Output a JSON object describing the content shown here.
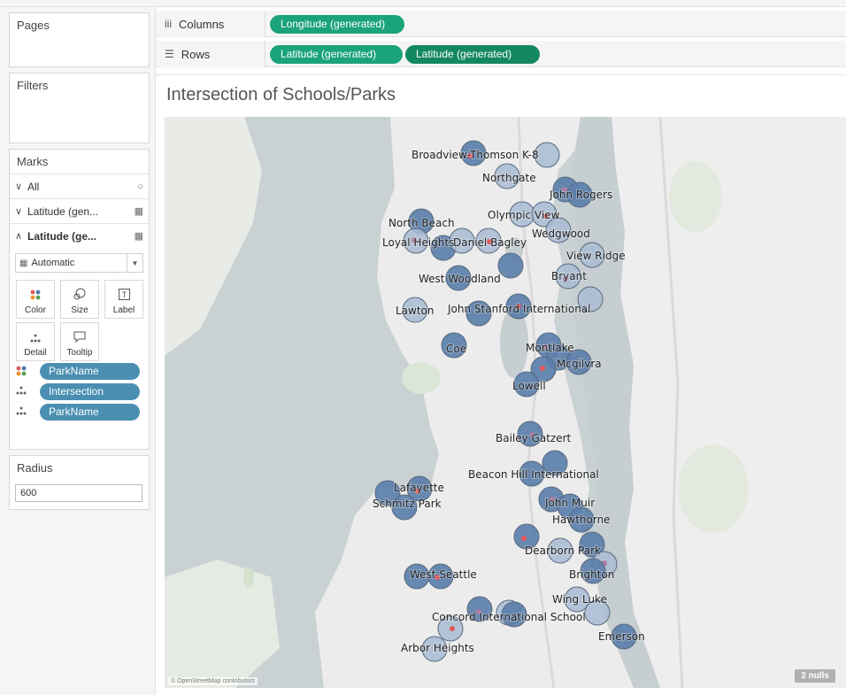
{
  "left_panel": {
    "pages": {
      "title": "Pages"
    },
    "filters": {
      "title": "Filters"
    },
    "marks": {
      "title": "Marks",
      "rows": [
        {
          "caret": "∨",
          "label": "All",
          "icon": "circle-icon"
        },
        {
          "caret": "∨",
          "label": "Latitude (gen...",
          "icon": "map-icon"
        },
        {
          "caret": "∧",
          "label": "Latitude (ge...",
          "icon": "map-icon"
        }
      ],
      "mark_type": "Automatic",
      "tiles": [
        {
          "label": "Color",
          "icon": "color-icon"
        },
        {
          "label": "Size",
          "icon": "size-icon"
        },
        {
          "label": "Label",
          "icon": "label-icon"
        },
        {
          "label": "Detail",
          "icon": "detail-icon"
        },
        {
          "label": "Tooltip",
          "icon": "tooltip-icon"
        }
      ],
      "pills": [
        {
          "label": "ParkName",
          "icon": "color-icon"
        },
        {
          "label": "Intersection",
          "icon": "detail-icon"
        },
        {
          "label": "ParkName",
          "icon": "detail-icon"
        }
      ]
    },
    "radius": {
      "title": "Radius",
      "value": "600"
    }
  },
  "shelves": {
    "columns": {
      "label": "Columns",
      "icon": "columns-icon",
      "pills": [
        "Longitude (generated)"
      ]
    },
    "rows": {
      "label": "Rows",
      "icon": "rows-icon",
      "pills": [
        "Latitude (generated)",
        "Latitude (generated)"
      ]
    }
  },
  "colors": {
    "pill_green": "#1ba37a",
    "pill_dark_green": "#13885f",
    "dim_pill": "#4a8fb2",
    "mark_blue": "#5b7faa",
    "mark_light": "#a9bcd4",
    "water": "#c7cfd2",
    "land": "#ececec"
  },
  "sheet": {
    "title": "Intersection of Schools/Parks",
    "attribution": "© OpenStreetMap contributors",
    "nulls": "2 nulls"
  },
  "map_labels": [
    "Broadview-Thomson K-8",
    "Northgate",
    "John Rogers",
    "Olympic View",
    "North Beach",
    "Wedgwood",
    "Loyal Heights",
    "Daniel Bagley",
    "View Ridge",
    "Bryant",
    "West Woodland",
    "Lawton",
    "John Stanford International",
    "Coe",
    "Montlake",
    "Mcgilvra",
    "Lowell",
    "Bailey Gatzert",
    "Beacon Hill International",
    "Lafayette",
    "Schmitz Park",
    "John Muir",
    "Hawthorne",
    "Dearborn Park",
    "West Seattle",
    "Brighton",
    "Wing Luke",
    "Concord International School",
    "Emerson",
    "Arbor Heights"
  ]
}
